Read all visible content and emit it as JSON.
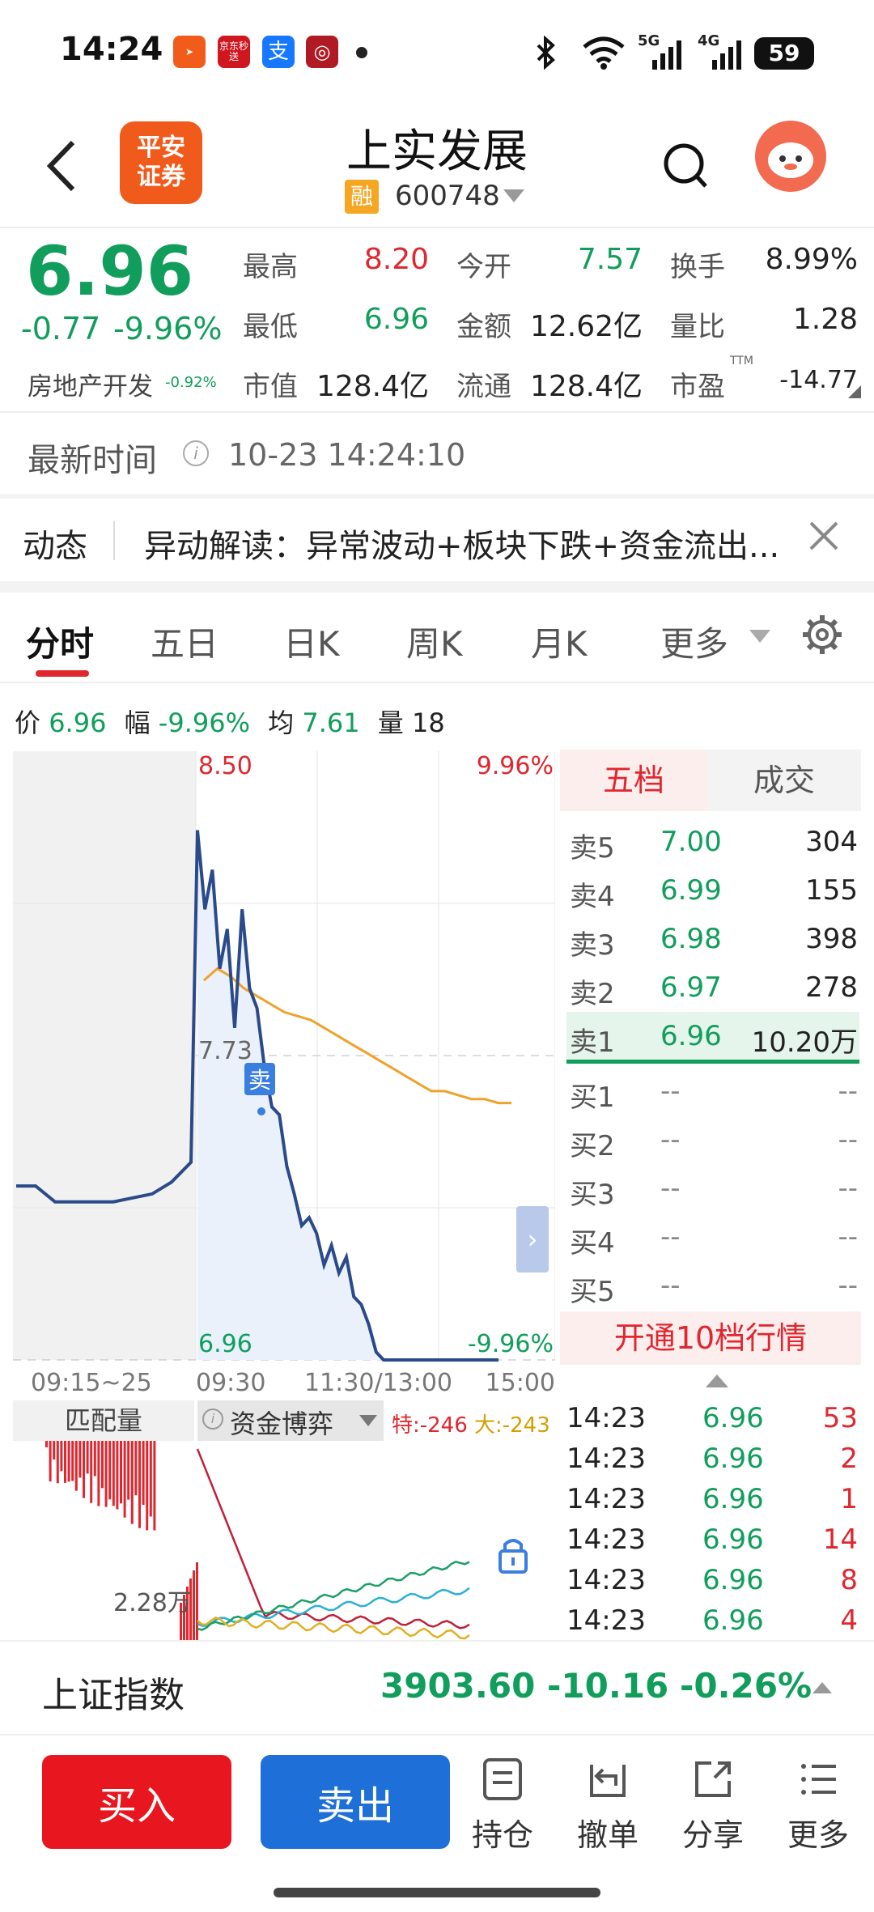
{
  "status_bar": {
    "time": "14:24",
    "battery": "59",
    "net1": "5G",
    "net2": "4G",
    "notif1": "京东秒送",
    "notif2": "支"
  },
  "header": {
    "title": "上实发展",
    "margin_badge": "融",
    "code": "600748",
    "broker": "平安\n证券"
  },
  "quote": {
    "price": "6.96",
    "change": "-0.77",
    "change_pct": "-9.96%",
    "sector": "房地产开发",
    "sector_pct": "-0.92%",
    "fields": [
      {
        "label": "最高",
        "value": "8.20"
      },
      {
        "label": "今开",
        "value": "7.57"
      },
      {
        "label": "换手",
        "value": "8.99%"
      },
      {
        "label": "最低",
        "value": "6.96"
      },
      {
        "label": "金额",
        "value": "12.62亿"
      },
      {
        "label": "量比",
        "value": "1.28"
      },
      {
        "label": "市值",
        "value": "128.4亿"
      },
      {
        "label": "流通",
        "value": "128.4亿"
      },
      {
        "label": "市盈",
        "value": "-14.77",
        "sup": "TTM"
      }
    ]
  },
  "update": {
    "label": "最新时间",
    "time": "10-23 14:24:10"
  },
  "news": {
    "label": "动态",
    "text": "异动解读：异常波动+板块下跌+资金流出..."
  },
  "tabs": [
    "分时",
    "五日",
    "日K",
    "周K",
    "月K",
    "更多"
  ],
  "chart_info": {
    "price_label": "价",
    "price": "6.96",
    "range_label": "幅",
    "range": "-9.96%",
    "avg_label": "均",
    "avg": "7.61",
    "vol_label": "量",
    "vol": "18"
  },
  "chart_data": {
    "type": "line",
    "x_ticks": [
      "09:15~25",
      "09:30",
      "11:30/13:00",
      "15:00"
    ],
    "y_top": "8.50",
    "y_top_pct": "9.96%",
    "y_bottom": "6.96",
    "y_bottom_pct": "-9.96%",
    "ref_label": "7.73",
    "sell_marker": "卖",
    "ylim": [
      6.96,
      8.5
    ],
    "price_series": [
      7.4,
      7.4,
      7.36,
      7.36,
      7.36,
      7.36,
      7.37,
      7.38,
      7.41,
      7.46,
      8.3,
      8.1,
      8.2,
      7.95,
      8.05,
      7.8,
      8.1,
      7.9,
      7.85,
      7.7,
      7.6,
      7.58,
      7.45,
      7.38,
      7.3,
      7.32,
      7.28,
      7.2,
      7.25,
      7.18,
      7.22,
      7.12,
      7.1,
      7.05,
      6.98,
      6.96,
      6.96,
      6.96,
      6.96
    ],
    "avg_series": [
      7.92,
      7.95,
      7.93,
      7.9,
      7.88,
      7.86,
      7.84,
      7.83,
      7.82,
      7.8,
      7.78,
      7.76,
      7.74,
      7.72,
      7.7,
      7.68,
      7.66,
      7.64,
      7.64,
      7.63,
      7.62,
      7.62,
      7.61,
      7.61
    ]
  },
  "orderbook": {
    "tabs": [
      "五档",
      "成交"
    ],
    "asks": [
      {
        "label": "卖5",
        "price": "7.00",
        "vol": "304"
      },
      {
        "label": "卖4",
        "price": "6.99",
        "vol": "155"
      },
      {
        "label": "卖3",
        "price": "6.98",
        "vol": "398"
      },
      {
        "label": "卖2",
        "price": "6.97",
        "vol": "278"
      },
      {
        "label": "卖1",
        "price": "6.96",
        "vol": "10.20万"
      }
    ],
    "bids": [
      {
        "label": "买1",
        "price": "--",
        "vol": "--"
      },
      {
        "label": "买2",
        "price": "--",
        "vol": "--"
      },
      {
        "label": "买3",
        "price": "--",
        "vol": "--"
      },
      {
        "label": "买4",
        "price": "--",
        "vol": "--"
      },
      {
        "label": "买5",
        "price": "--",
        "vol": "--"
      }
    ],
    "upgrade": "开通10档行情"
  },
  "sub_chart": {
    "tab1": "匹配量",
    "tab2": "资金博弈",
    "special": "特:-246",
    "big": "大:-243",
    "level": "2.28万"
  },
  "ticks": [
    {
      "time": "14:23",
      "price": "6.96",
      "vol": "53"
    },
    {
      "time": "14:23",
      "price": "6.96",
      "vol": "2"
    },
    {
      "time": "14:23",
      "price": "6.96",
      "vol": "1"
    },
    {
      "time": "14:23",
      "price": "6.96",
      "vol": "14"
    },
    {
      "time": "14:23",
      "price": "6.96",
      "vol": "8"
    },
    {
      "time": "14:23",
      "price": "6.96",
      "vol": "4"
    }
  ],
  "index_bar": {
    "name": "上证指数",
    "value": "3903.60",
    "change": "-10.16",
    "pct": "-0.26%"
  },
  "bottom": {
    "buy": "买入",
    "sell": "卖出",
    "tools": [
      "持仓",
      "撤单",
      "分享",
      "更多"
    ]
  }
}
